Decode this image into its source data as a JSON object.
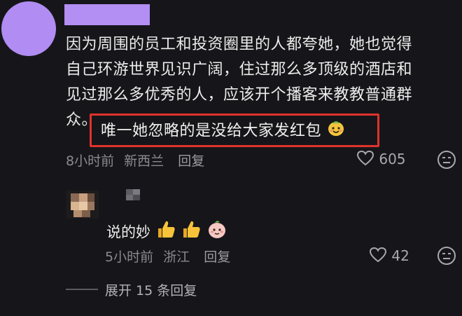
{
  "main_comment": {
    "text": "因为周围的员工和投资圈里的人都夸她，她也觉得\n自己环游世界见识广阔，住过那么多顶级的酒店和\n见过那么多优秀的人，应该开个播客来教教普通群\n众。",
    "highlight": "唯一她忽略的是没给大家发红包",
    "time": "8小时前",
    "location": "新西兰",
    "reply_label": "回复",
    "likes": "605"
  },
  "reply": {
    "text": "说的妙",
    "time": "5小时前",
    "location": "浙江",
    "reply_label": "回复",
    "likes": "42"
  },
  "expand": {
    "label": "展开 15 条回复"
  },
  "colors": {
    "background": "#16161a",
    "highlight_border": "#e0322b",
    "avatar_placeholder": "#b18cf2"
  },
  "icons": [
    "heart-outline-icon",
    "dislike-face-icon",
    "thumbs-up-emoji",
    "smiling-face-emoji"
  ]
}
